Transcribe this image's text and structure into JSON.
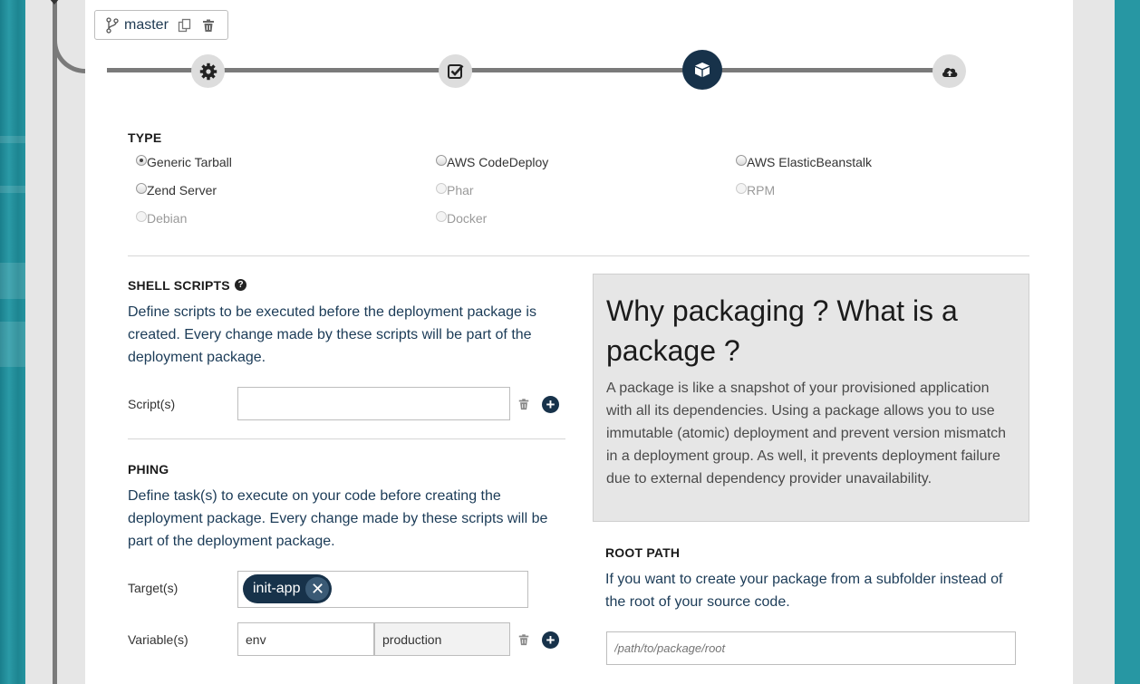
{
  "branch": {
    "name": "master",
    "icons": [
      "branch-icon",
      "copy-icon",
      "trash-icon"
    ]
  },
  "pipeline": {
    "steps": [
      {
        "name": "settings",
        "icon": "gear-icon",
        "active": false
      },
      {
        "name": "test",
        "icon": "checkbox-icon",
        "active": false
      },
      {
        "name": "package",
        "icon": "box-icon",
        "active": true
      },
      {
        "name": "deploy",
        "icon": "cloud-upload-icon",
        "active": false
      }
    ]
  },
  "type": {
    "title": "TYPE",
    "options": [
      {
        "label": "Generic Tarball",
        "checked": true,
        "disabled": false
      },
      {
        "label": "AWS CodeDeploy",
        "checked": false,
        "disabled": false
      },
      {
        "label": "AWS ElasticBeanstalk",
        "checked": false,
        "disabled": false
      },
      {
        "label": "Zend Server",
        "checked": false,
        "disabled": false
      },
      {
        "label": "Phar",
        "checked": false,
        "disabled": true
      },
      {
        "label": "RPM",
        "checked": false,
        "disabled": true
      },
      {
        "label": "Debian",
        "checked": false,
        "disabled": true
      },
      {
        "label": "Docker",
        "checked": false,
        "disabled": true
      }
    ]
  },
  "shell": {
    "title": "SHELL SCRIPTS",
    "help_icon": "question-icon",
    "description": "Define scripts to be executed before the deployment package is created. Every change made by these scripts will be part of the deployment package.",
    "scripts_label": "Script(s)",
    "scripts_value": ""
  },
  "phing": {
    "title": "PHING",
    "description": "Define task(s) to execute on your code before creating the deployment package. Every change made by these scripts will be part of the deployment package.",
    "targets_label": "Target(s)",
    "targets": [
      "init-app"
    ],
    "variables_label": "Variable(s)",
    "variables": [
      {
        "key": "env",
        "value": "production"
      }
    ]
  },
  "info": {
    "heading": "Why packaging ? What is a package ?",
    "body": "A package is like a snapshot of your provisioned application with all its dependencies. Using a package allows you to use immutable (atomic) deployment and prevent version mismatch in a deployment group. As well, it prevents deployment failure due to external dependency provider unavailability."
  },
  "root_path": {
    "title": "ROOT PATH",
    "description": "If you want to create your package from a subfolder instead of the root of your source code.",
    "placeholder": "/path/to/package/root"
  },
  "colors": {
    "primary": "#17324a",
    "text_blue": "#1b3b57",
    "rail": "#7a7a7a",
    "frame": "#e6e6e6"
  }
}
